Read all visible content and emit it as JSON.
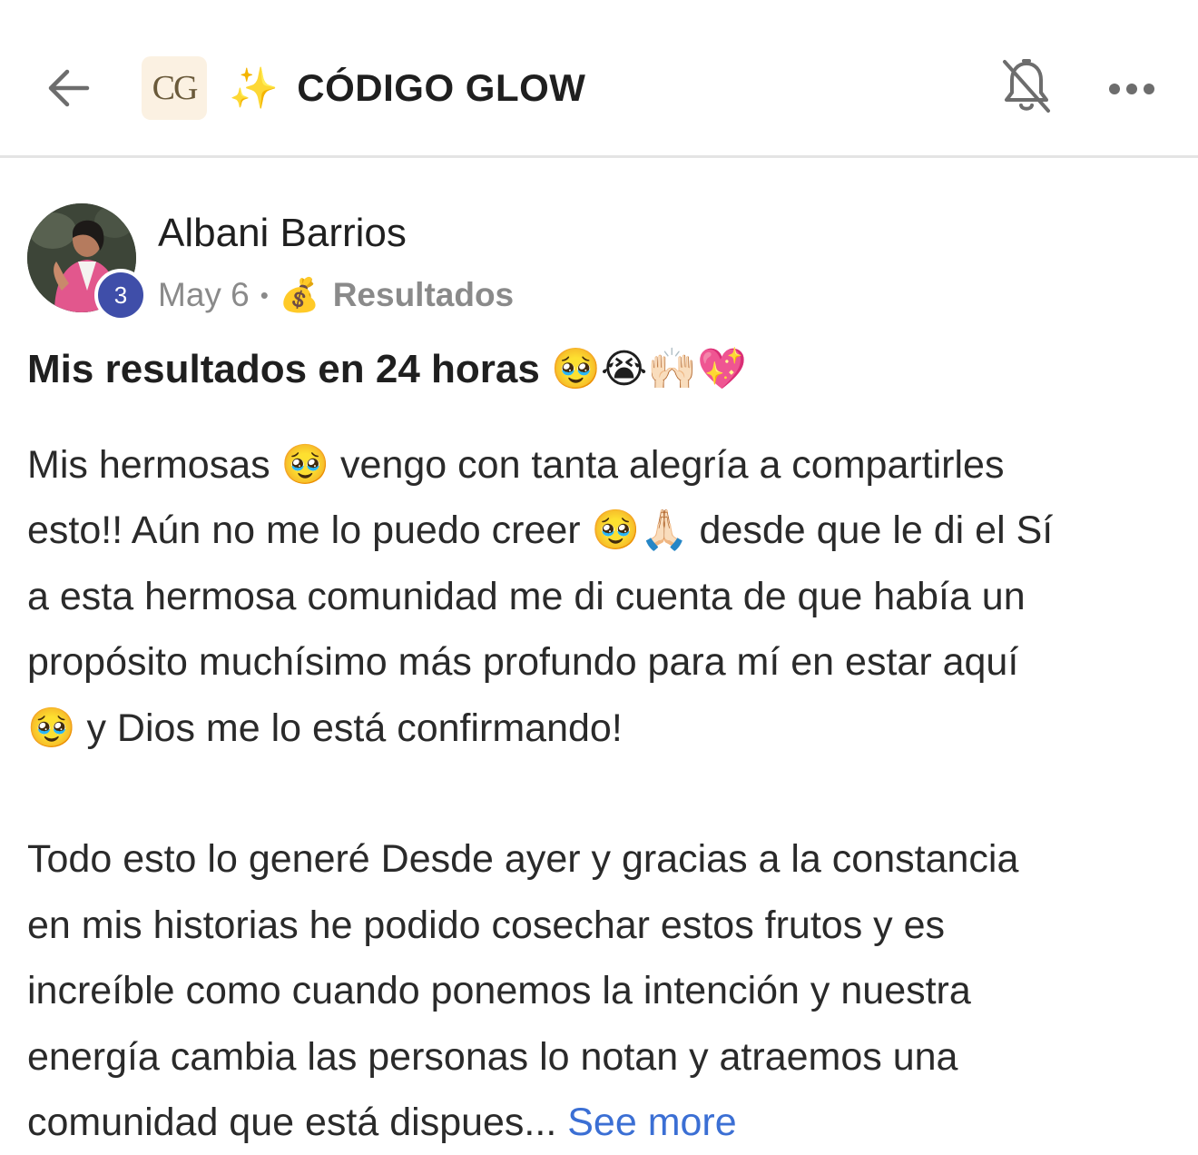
{
  "header": {
    "logo_text": "CG",
    "title_emoji": "✨",
    "title": "CÓDIGO GLOW",
    "icons": {
      "back": "back-arrow-icon",
      "bell": "bell-muted-icon",
      "more": "more-dots-icon"
    }
  },
  "post": {
    "author": {
      "name": "Albani Barrios",
      "level": "3"
    },
    "date": "May 6",
    "separator": "•",
    "category_emoji": "💰",
    "category": "Resultados",
    "title": "Mis resultados en 24 horas 🥹😭🙌🏻💖",
    "body_lines": [
      "Mis hermosas 🥹 vengo con tanta alegría a compartirles",
      "esto!! Aún no me lo puedo creer 🥹🙏🏻 desde que le di el Sí",
      "a esta hermosa comunidad me di cuenta de que había un",
      "propósito muchísimo más profundo para mí en estar aquí",
      "🥹 y Dios me lo está confirmando!"
    ],
    "body_lines_2": [
      "Todo esto lo generé Desde ayer y gracias a la constancia",
      "en mis historias he podido cosechar estos frutos y es",
      "increíble como cuando ponemos la intención y nuestra",
      "energía cambia las personas lo notan y atraemos una"
    ],
    "last_line": "comunidad que está dispues...",
    "see_more": "See more"
  },
  "colors": {
    "accent_link": "#3b6fd4",
    "level_badge": "#3f4ea9",
    "logo_bg": "#fbf1e2",
    "muted_text": "#8a8a8a"
  }
}
